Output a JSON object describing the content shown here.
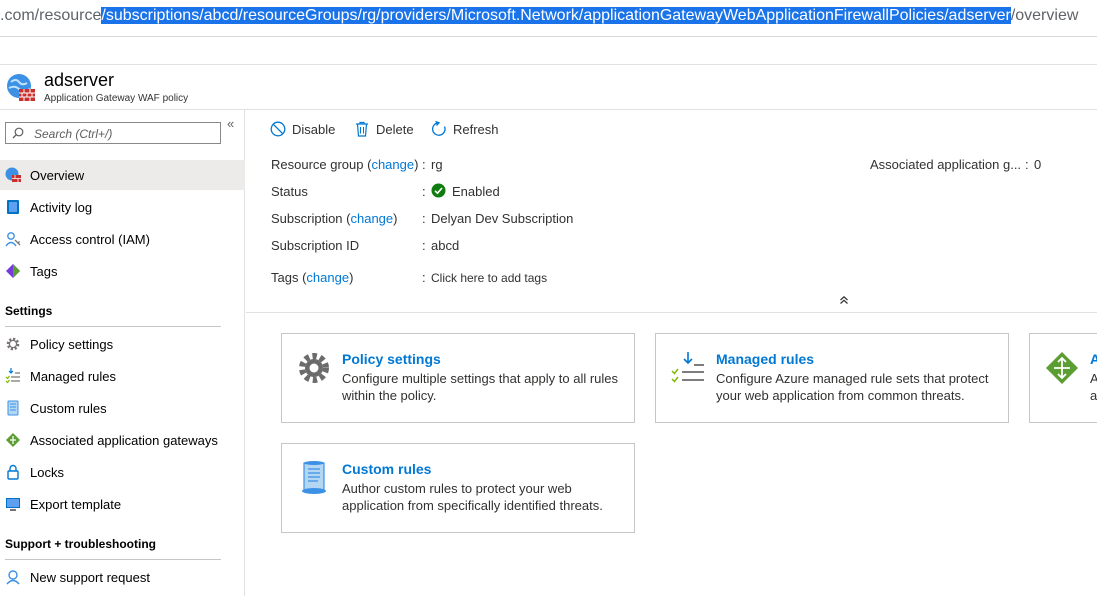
{
  "browser": {
    "url_prefix": ".com/resource",
    "url_selected": "/subscriptions/abcd/resourceGroups/rg/providers/Microsoft.Network/applicationGatewayWebApplicationFirewallPolicies/adserver",
    "url_suffix": "/overview"
  },
  "resource": {
    "title": "adserver",
    "subtitle": "Application Gateway WAF policy"
  },
  "sidebar": {
    "search_placeholder": "Search (Ctrl+/)",
    "collapse_glyph": "«",
    "items": [
      {
        "label": "Overview",
        "icon": "waf-policy-icon"
      },
      {
        "label": "Activity log",
        "icon": "activity-log-icon"
      },
      {
        "label": "Access control (IAM)",
        "icon": "iam-icon"
      },
      {
        "label": "Tags",
        "icon": "tag-icon"
      }
    ],
    "settings_header": "Settings",
    "settings_items": [
      {
        "label": "Policy settings",
        "icon": "gear-icon"
      },
      {
        "label": "Managed rules",
        "icon": "managed-rules-icon"
      },
      {
        "label": "Custom rules",
        "icon": "custom-rules-icon"
      },
      {
        "label": "Associated application gateways",
        "icon": "app-gateway-icon"
      },
      {
        "label": "Locks",
        "icon": "lock-icon"
      },
      {
        "label": "Export template",
        "icon": "export-template-icon"
      }
    ],
    "support_header": "Support + troubleshooting",
    "support_items": [
      {
        "label": "New support request",
        "icon": "support-icon"
      }
    ]
  },
  "toolbar": {
    "disable": "Disable",
    "delete": "Delete",
    "refresh": "Refresh"
  },
  "essentials": {
    "resource_group_label": "Resource group (",
    "change": "change",
    "close_paren": ")",
    "resource_group_value": "rg",
    "status_label": "Status",
    "status_value": "Enabled",
    "subscription_label": "Subscription (",
    "subscription_value": "Delyan Dev Subscription",
    "subscription_id_label": "Subscription ID",
    "subscription_id_value": "abcd",
    "tags_label": "Tags (",
    "tags_value": "Click here to add tags",
    "assoc_label": "Associated application g...",
    "assoc_value": "0",
    "colon": ":",
    "collapse_glyph": "⌃"
  },
  "tiles": {
    "policy_settings": {
      "title": "Policy settings",
      "desc": "Configure multiple settings that apply to all rules within the policy."
    },
    "managed_rules": {
      "title": "Managed rules",
      "desc": "Configure Azure managed rule sets that protect your web application from common threats."
    },
    "associated": {
      "title": "A",
      "desc_line1": "A",
      "desc_line2": "a"
    },
    "custom_rules": {
      "title": "Custom rules",
      "desc": "Author custom rules to protect your web application from specifically identified threats."
    }
  },
  "colors": {
    "accent": "#0078d4",
    "success": "#107c10",
    "active_bg": "#edebe9"
  }
}
